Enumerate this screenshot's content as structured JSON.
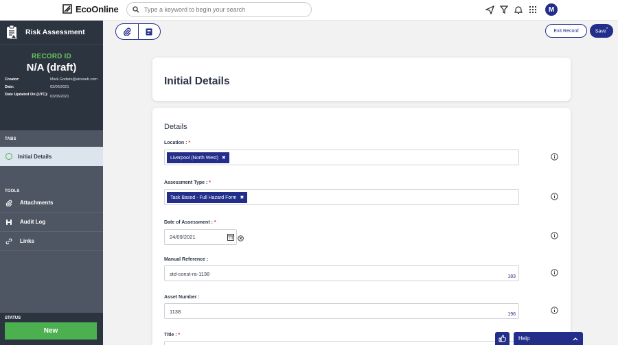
{
  "topbar": {
    "brand": "EcoOnline",
    "search_placeholder": "Type a keyword to begin your search",
    "avatar_initial": "M"
  },
  "sidebar": {
    "title": "Risk Assessment",
    "record_id_label": "RECORD ID",
    "record_id_value": "N/A (draft)",
    "meta": [
      {
        "key": "Creator:",
        "value": "Mark.Godwin@airsweb.com"
      },
      {
        "key": "Date:",
        "value": "03/06/2021"
      },
      {
        "key": "Date Updated On (UTC):",
        "value": "03/06/2021"
      }
    ],
    "tabs_label": "TABS",
    "tabs": [
      {
        "label": "Initial Details"
      }
    ],
    "tools_label": "TOOLS",
    "tools": [
      {
        "label": "Attachments",
        "icon": "paperclip-icon"
      },
      {
        "label": "Audit Log",
        "icon": "save-icon"
      },
      {
        "label": "Links",
        "icon": "link-icon"
      }
    ],
    "status_label": "STATUS",
    "status_button": "New"
  },
  "actions": {
    "exit_label": "Exit Record",
    "save_label": "Save",
    "save_marker": "*"
  },
  "page_title": "Initial Details",
  "form": {
    "heading": "Details",
    "location": {
      "label": "Location :",
      "required": "*",
      "chip": "Liverpool (North West)"
    },
    "assessment_type": {
      "label": "Assessment Type :",
      "required": "*",
      "chip": "Task Based - Full Hazard Form"
    },
    "date": {
      "label": "Date of Assessment :",
      "required": "*",
      "value": "24/09/2021"
    },
    "manual_reference": {
      "label": "Manual Reference :",
      "value": "std-const-ra-1138",
      "remaining": "183"
    },
    "asset_number": {
      "label": "Asset Number :",
      "value": "1138",
      "remaining": "196"
    },
    "title": {
      "label": "Title :",
      "required": "*"
    }
  },
  "help": {
    "label": "Help"
  },
  "colors": {
    "brand_navy": "#232d8a",
    "sidebar_dark": "#2c3440",
    "sidebar": "#4d5662",
    "accent_green": "#4caf50"
  }
}
